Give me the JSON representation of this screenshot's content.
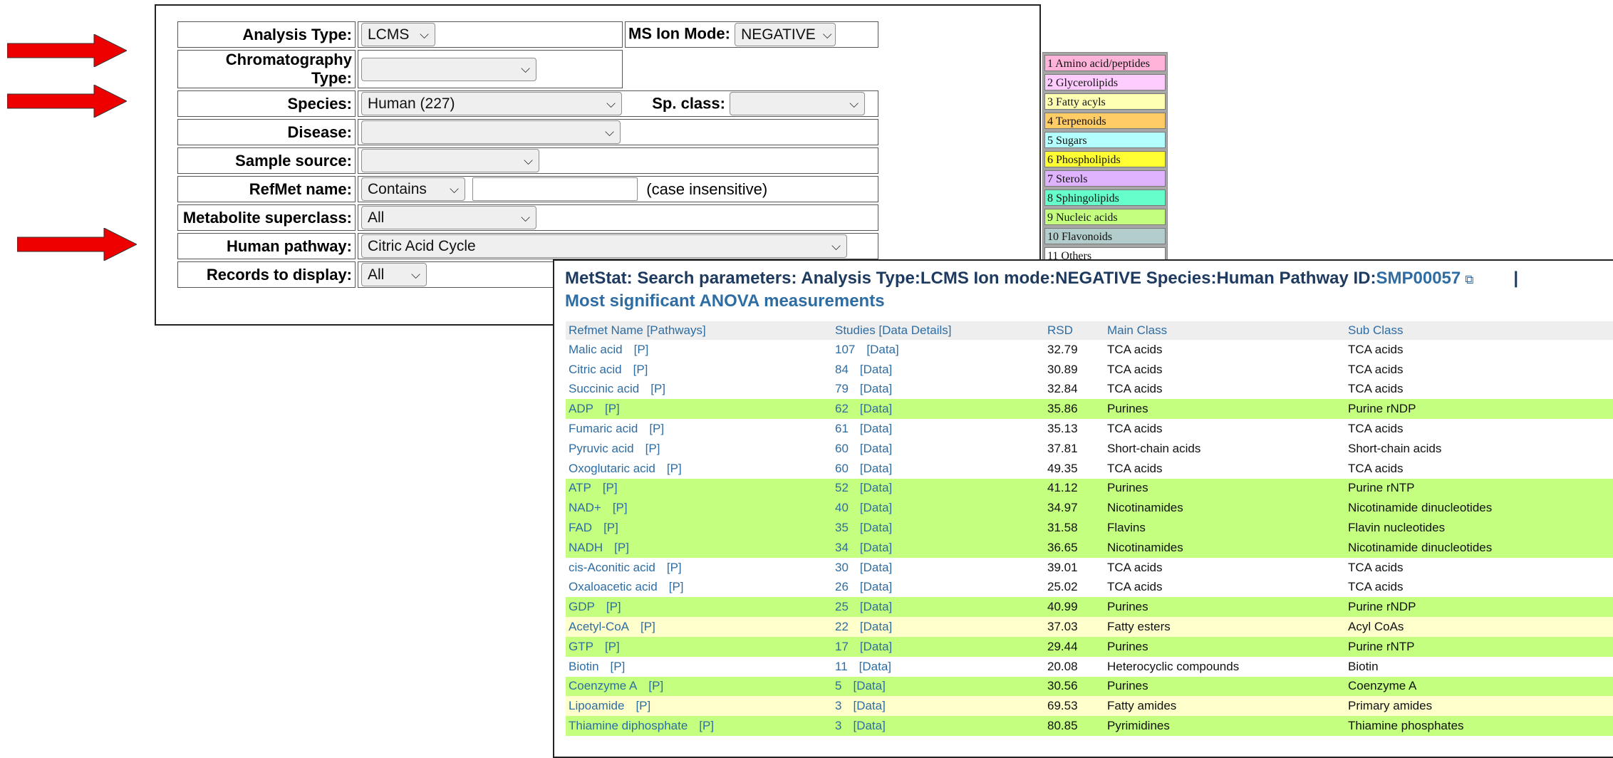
{
  "form": {
    "analysis_type_label": "Analysis Type:",
    "analysis_type_value": "LCMS",
    "ms_ion_mode_label": "MS Ion Mode:",
    "ms_ion_mode_value": "NEGATIVE",
    "chromatography_label": "Chromatography Type:",
    "chromatography_value": "",
    "species_label": "Species:",
    "species_value": "Human (227)",
    "sp_class_label": "Sp. class:",
    "sp_class_value": "",
    "disease_label": "Disease:",
    "disease_value": "",
    "sample_source_label": "Sample source:",
    "sample_source_value": "",
    "refmet_label": "RefMet name:",
    "refmet_match_value": "Contains",
    "refmet_text_value": "",
    "refmet_note": "(case insensitive)",
    "superclass_label": "Metabolite superclass:",
    "superclass_value": "All",
    "pathway_label": "Human pathway:",
    "pathway_value": "Citric Acid Cycle",
    "records_label": "Records to display:",
    "records_value": "All"
  },
  "legend": [
    {
      "label": "1 Amino acid/peptides",
      "color": "#ffb3d9"
    },
    {
      "label": "2 Glycerolipids",
      "color": "#ffccff"
    },
    {
      "label": "3 Fatty acyls",
      "color": "#ffffb3"
    },
    {
      "label": "4 Terpenoids",
      "color": "#ffcc66"
    },
    {
      "label": "5 Sugars",
      "color": "#b3ffff"
    },
    {
      "label": "6 Phospholipids",
      "color": "#ffff33"
    },
    {
      "label": "7 Sterols",
      "color": "#e0b3ff"
    },
    {
      "label": "8 Sphingolipids",
      "color": "#66ffcc"
    },
    {
      "label": "9 Nucleic acids",
      "color": "#c4ff80"
    },
    {
      "label": "10 Flavonoids",
      "color": "#b3cccc"
    },
    {
      "label": "11 Others",
      "color": "#ffffff"
    }
  ],
  "results": {
    "title_prefix": "MetStat: Search parameters: Analysis Type:LCMS Ion mode:NEGATIVE Species:Human Pathway ID:",
    "pathway_id": "SMP00057",
    "external_icon": "external-link-icon",
    "separator": "|",
    "subtitle": "Most significant ANOVA measurements",
    "columns": [
      "Refmet Name [Pathways]",
      "Studies [Data Details]",
      "RSD",
      "Main Class",
      "Sub Class"
    ],
    "rows": [
      {
        "name": "Malic acid",
        "p": "[P]",
        "studies": "107",
        "data": "[Data]",
        "rsd": "32.79",
        "main": "TCA acids",
        "sub": "TCA acids",
        "row_color": "white"
      },
      {
        "name": "Citric acid",
        "p": "[P]",
        "studies": "84",
        "data": "[Data]",
        "rsd": "30.89",
        "main": "TCA acids",
        "sub": "TCA acids",
        "row_color": "white"
      },
      {
        "name": "Succinic acid",
        "p": "[P]",
        "studies": "79",
        "data": "[Data]",
        "rsd": "32.84",
        "main": "TCA acids",
        "sub": "TCA acids",
        "row_color": "white"
      },
      {
        "name": "ADP",
        "p": "[P]",
        "studies": "62",
        "data": "[Data]",
        "rsd": "35.86",
        "main": "Purines",
        "sub": "Purine rNDP",
        "row_color": "green"
      },
      {
        "name": "Fumaric acid",
        "p": "[P]",
        "studies": "61",
        "data": "[Data]",
        "rsd": "35.13",
        "main": "TCA acids",
        "sub": "TCA acids",
        "row_color": "white"
      },
      {
        "name": "Pyruvic acid",
        "p": "[P]",
        "studies": "60",
        "data": "[Data]",
        "rsd": "37.81",
        "main": "Short-chain acids",
        "sub": "Short-chain acids",
        "row_color": "white"
      },
      {
        "name": "Oxoglutaric acid",
        "p": "[P]",
        "studies": "60",
        "data": "[Data]",
        "rsd": "49.35",
        "main": "TCA acids",
        "sub": "TCA acids",
        "row_color": "white"
      },
      {
        "name": "ATP",
        "p": "[P]",
        "studies": "52",
        "data": "[Data]",
        "rsd": "41.12",
        "main": "Purines",
        "sub": "Purine rNTP",
        "row_color": "green"
      },
      {
        "name": "NAD+",
        "p": "[P]",
        "studies": "40",
        "data": "[Data]",
        "rsd": "34.97",
        "main": "Nicotinamides",
        "sub": "Nicotinamide dinucleotides",
        "row_color": "green"
      },
      {
        "name": "FAD",
        "p": "[P]",
        "studies": "35",
        "data": "[Data]",
        "rsd": "31.58",
        "main": "Flavins",
        "sub": "Flavin nucleotides",
        "row_color": "green"
      },
      {
        "name": "NADH",
        "p": "[P]",
        "studies": "34",
        "data": "[Data]",
        "rsd": "36.65",
        "main": "Nicotinamides",
        "sub": "Nicotinamide dinucleotides",
        "row_color": "green"
      },
      {
        "name": "cis-Aconitic acid",
        "p": "[P]",
        "studies": "30",
        "data": "[Data]",
        "rsd": "39.01",
        "main": "TCA acids",
        "sub": "TCA acids",
        "row_color": "white"
      },
      {
        "name": "Oxaloacetic acid",
        "p": "[P]",
        "studies": "26",
        "data": "[Data]",
        "rsd": "25.02",
        "main": "TCA acids",
        "sub": "TCA acids",
        "row_color": "white"
      },
      {
        "name": "GDP",
        "p": "[P]",
        "studies": "25",
        "data": "[Data]",
        "rsd": "40.99",
        "main": "Purines",
        "sub": "Purine rNDP",
        "row_color": "green"
      },
      {
        "name": "Acetyl-CoA",
        "p": "[P]",
        "studies": "22",
        "data": "[Data]",
        "rsd": "37.03",
        "main": "Fatty esters",
        "sub": "Acyl CoAs",
        "row_color": "yellow"
      },
      {
        "name": "GTP",
        "p": "[P]",
        "studies": "17",
        "data": "[Data]",
        "rsd": "29.44",
        "main": "Purines",
        "sub": "Purine rNTP",
        "row_color": "green"
      },
      {
        "name": "Biotin",
        "p": "[P]",
        "studies": "11",
        "data": "[Data]",
        "rsd": "20.08",
        "main": "Heterocyclic compounds",
        "sub": "Biotin",
        "row_color": "white"
      },
      {
        "name": "Coenzyme A",
        "p": "[P]",
        "studies": "5",
        "data": "[Data]",
        "rsd": "30.56",
        "main": "Purines",
        "sub": "Coenzyme A",
        "row_color": "green"
      },
      {
        "name": "Lipoamide",
        "p": "[P]",
        "studies": "3",
        "data": "[Data]",
        "rsd": "69.53",
        "main": "Fatty amides",
        "sub": "Primary amides",
        "row_color": "yellow"
      },
      {
        "name": "Thiamine diphosphate",
        "p": "[P]",
        "studies": "3",
        "data": "[Data]",
        "rsd": "80.85",
        "main": "Pyrimidines",
        "sub": "Thiamine phosphates",
        "row_color": "green"
      }
    ]
  },
  "arrows": {
    "color": "#ee0000",
    "icon": "right-arrow-icon"
  }
}
